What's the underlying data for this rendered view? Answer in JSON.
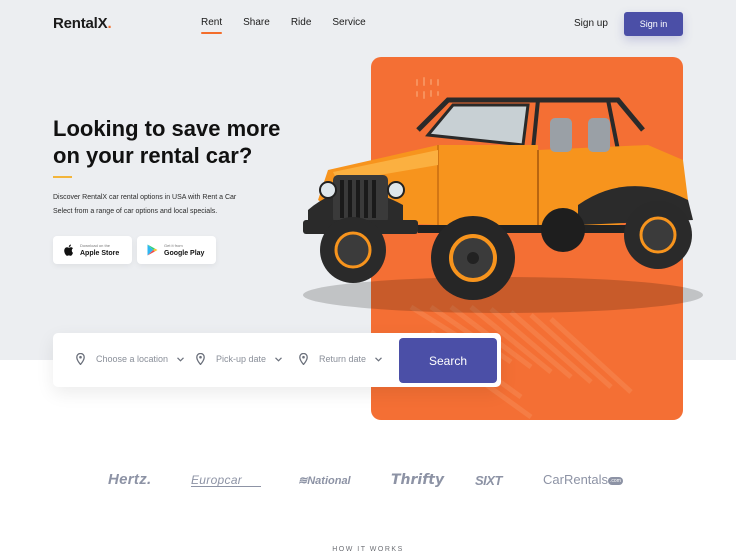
{
  "header": {
    "logo": "RentalX",
    "logo_dot": ".",
    "nav": [
      {
        "label": "Rent",
        "active": true
      },
      {
        "label": "Share",
        "active": false
      },
      {
        "label": "Ride",
        "active": false
      },
      {
        "label": "Service",
        "active": false
      }
    ],
    "signup_label": "Sign up",
    "signin_label": "Sign in"
  },
  "hero": {
    "headline": "Looking to save more on your rental car?",
    "description_line1": "Discover RentalX car rental options in USA with  Rent a Car",
    "description_line2": "Select from a range of car options and local specials."
  },
  "stores": {
    "apple": {
      "small": "Download on the",
      "big": "Apple Store",
      "icon": "apple-icon"
    },
    "google": {
      "small": "Get it from",
      "big": "Google Play",
      "icon": "play-store-icon"
    }
  },
  "search": {
    "location_placeholder": "Choose a location",
    "pickup_placeholder": "Pick-up date",
    "return_placeholder": "Return date",
    "button_label": "Search"
  },
  "brands": {
    "hertz": "Hertz.",
    "europcar": "Europcar",
    "national": "National",
    "thrifty": "Thrifty",
    "sixt": "SIXT",
    "carrentals": "CarRentals",
    "carrentals_suffix": ".com"
  },
  "section_title": "HOW IT WORKS",
  "colors": {
    "accent_orange": "#f46f34",
    "primary_indigo": "#4b4fa7",
    "hero_bg": "#eceef1",
    "brand_gray": "#8d93a5",
    "underline_yellow": "#f3b53b"
  }
}
